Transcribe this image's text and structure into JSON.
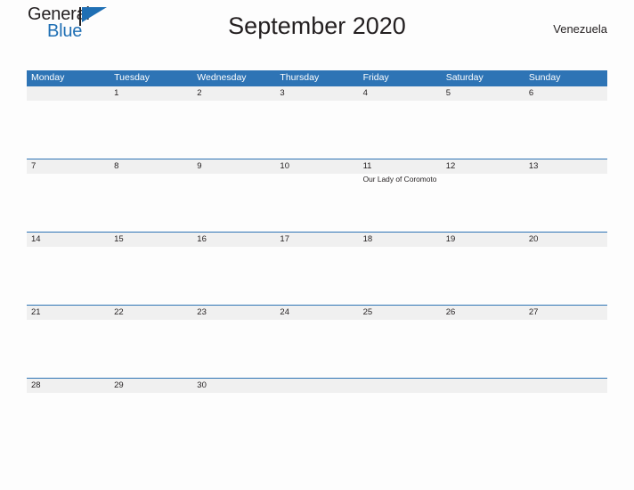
{
  "brand": {
    "name_part1": "General",
    "name_part2": "Blue",
    "flag_icon": "flag-triangle-icon",
    "accent_color": "#1f6fb4"
  },
  "header": {
    "title": "September 2020",
    "country": "Venezuela"
  },
  "theme": {
    "header_blue": "#2e74b5",
    "band_gray": "#f0f0f0",
    "page_bg": "#fdfdfd",
    "text_dark": "#231f20"
  },
  "calendar": {
    "weekdays": [
      "Monday",
      "Tuesday",
      "Wednesday",
      "Thursday",
      "Friday",
      "Saturday",
      "Sunday"
    ],
    "weeks": [
      [
        {
          "day": ""
        },
        {
          "day": "1"
        },
        {
          "day": "2"
        },
        {
          "day": "3"
        },
        {
          "day": "4"
        },
        {
          "day": "5"
        },
        {
          "day": "6"
        }
      ],
      [
        {
          "day": "7"
        },
        {
          "day": "8"
        },
        {
          "day": "9"
        },
        {
          "day": "10"
        },
        {
          "day": "11",
          "event": "Our Lady of Coromoto"
        },
        {
          "day": "12"
        },
        {
          "day": "13"
        }
      ],
      [
        {
          "day": "14"
        },
        {
          "day": "15"
        },
        {
          "day": "16"
        },
        {
          "day": "17"
        },
        {
          "day": "18"
        },
        {
          "day": "19"
        },
        {
          "day": "20"
        }
      ],
      [
        {
          "day": "21"
        },
        {
          "day": "22"
        },
        {
          "day": "23"
        },
        {
          "day": "24"
        },
        {
          "day": "25"
        },
        {
          "day": "26"
        },
        {
          "day": "27"
        }
      ],
      [
        {
          "day": "28"
        },
        {
          "day": "29"
        },
        {
          "day": "30"
        },
        {
          "day": ""
        },
        {
          "day": ""
        },
        {
          "day": ""
        },
        {
          "day": ""
        }
      ]
    ]
  }
}
